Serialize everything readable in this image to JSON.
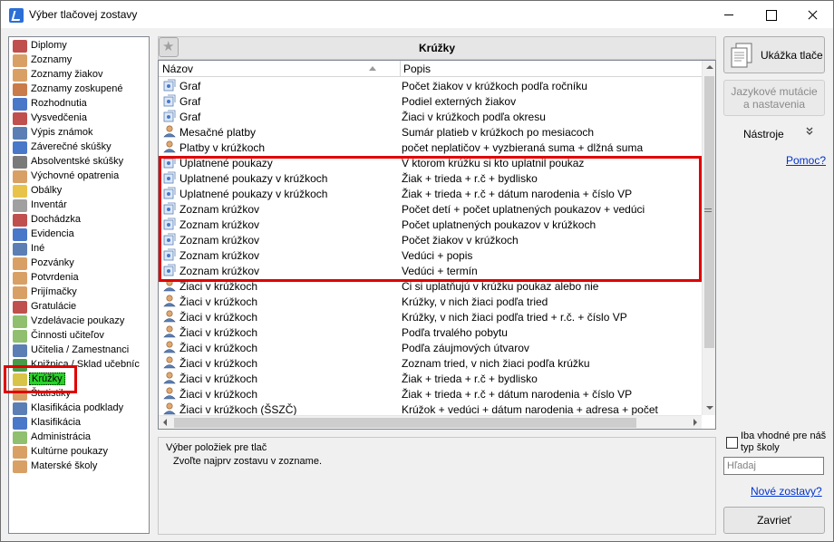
{
  "window": {
    "title": "Výber tlačovej zostavy"
  },
  "categories": [
    {
      "label": "Diplomy",
      "icon": "diploma-icon",
      "color": "#c0504d"
    },
    {
      "label": "Zoznamy",
      "icon": "person-icon",
      "color": "#d9a066"
    },
    {
      "label": "Zoznamy žiakov",
      "icon": "student-icon",
      "color": "#d9a066"
    },
    {
      "label": "Zoznamy zoskupené",
      "icon": "group-icon",
      "color": "#c97b4a"
    },
    {
      "label": "Rozhodnutia",
      "icon": "document-icon",
      "color": "#4a78c9"
    },
    {
      "label": "Vysvedčenia",
      "icon": "certificate-icon",
      "color": "#c0504d"
    },
    {
      "label": "Výpis známok",
      "icon": "grades-icon",
      "color": "#5b7fb5"
    },
    {
      "label": "Záverečné skúšky",
      "icon": "exam-icon",
      "color": "#4a78c9"
    },
    {
      "label": "Absolventské skúšky",
      "icon": "exam-icon",
      "color": "#7a7a7a"
    },
    {
      "label": "Výchovné opatrenia",
      "icon": "person-icon",
      "color": "#d9a066"
    },
    {
      "label": "Obálky",
      "icon": "envelope-icon",
      "color": "#e8c34a"
    },
    {
      "label": "Inventár",
      "icon": "inventory-icon",
      "color": "#a0a0a0"
    },
    {
      "label": "Dochádzka",
      "icon": "attendance-icon",
      "color": "#c0504d"
    },
    {
      "label": "Evidencia",
      "icon": "records-icon",
      "color": "#4a78c9"
    },
    {
      "label": "Iné",
      "icon": "person-icon",
      "color": "#5b7fb5"
    },
    {
      "label": "Pozvánky",
      "icon": "person-icon",
      "color": "#d9a066"
    },
    {
      "label": "Potvrdenia",
      "icon": "person-icon",
      "color": "#d9a066"
    },
    {
      "label": "Prijímačky",
      "icon": "person-icon",
      "color": "#d9a066"
    },
    {
      "label": "Gratulácie",
      "icon": "gift-icon",
      "color": "#c0504d"
    },
    {
      "label": "Vzdelávacie poukazy",
      "icon": "check-icon",
      "color": "#8fbf6f"
    },
    {
      "label": "Činnosti učiteľov",
      "icon": "check-icon",
      "color": "#8fbf6f"
    },
    {
      "label": "Učitelia / Zamestnanci",
      "icon": "teacher-icon",
      "color": "#5b7fb5"
    },
    {
      "label": "Knižnica / Sklad učebníc",
      "icon": "book-icon",
      "color": "#4a9a4a"
    },
    {
      "label": "Krúžky",
      "icon": "hobby-group-icon",
      "color": "#d9c44a",
      "selected": true
    },
    {
      "label": "Štatistiky",
      "icon": "statistics-icon",
      "color": "#d9a066"
    },
    {
      "label": "Klasifikácia podklady",
      "icon": "classification-icon",
      "color": "#5b7fb5"
    },
    {
      "label": "Klasifikácia",
      "icon": "grid-icon",
      "color": "#4a78c9"
    },
    {
      "label": "Administrácia",
      "icon": "admin-icon",
      "color": "#8fbf6f"
    },
    {
      "label": "Kultúrne poukazy",
      "icon": "culture-icon",
      "color": "#d9a066"
    },
    {
      "label": "Materské školy",
      "icon": "kindergarten-icon",
      "color": "#d9a066"
    }
  ],
  "main": {
    "title": "Krúžky",
    "columns": {
      "name": "Názov",
      "description": "Popis"
    },
    "rows": [
      {
        "name": "Graf",
        "description": "Počet žiakov v krúžkoch podľa ročníku",
        "icon": "report-icon"
      },
      {
        "name": "Graf",
        "description": "Podiel externých žiakov",
        "icon": "report-icon"
      },
      {
        "name": "Graf",
        "description": "Žiaci v krúžkoch podľa okresu",
        "icon": "report-icon"
      },
      {
        "name": "Mesačné platby",
        "description": "Sumár platieb v krúžkoch po mesiacoch",
        "icon": "person-report-icon"
      },
      {
        "name": "Platby v krúžkoch",
        "description": "počet neplatičov + vyzbieraná suma + dlžná suma",
        "icon": "person-report-icon"
      },
      {
        "name": "Uplatnené poukazy",
        "description": "V ktorom krúžku si kto uplatnil poukaz",
        "icon": "report-icon"
      },
      {
        "name": "Uplatnené poukazy v krúžkoch",
        "description": "Žiak + trieda + r.č + bydlisko",
        "icon": "report-icon"
      },
      {
        "name": "Uplatnené poukazy v krúžkoch",
        "description": "Žiak + trieda + r.č + dátum narodenia + číslo VP",
        "icon": "report-icon"
      },
      {
        "name": "Zoznam krúžkov",
        "description": "Počet detí + počet uplatnených poukazov + vedúci",
        "icon": "report-icon"
      },
      {
        "name": "Zoznam krúžkov",
        "description": "Počet uplatnených poukazov v krúžkoch",
        "icon": "report-icon"
      },
      {
        "name": "Zoznam krúžkov",
        "description": "Počet žiakov v krúžkoch",
        "icon": "report-icon"
      },
      {
        "name": "Zoznam krúžkov",
        "description": "Vedúci + popis",
        "icon": "report-icon"
      },
      {
        "name": "Zoznam krúžkov",
        "description": "Vedúci + termín",
        "icon": "report-icon"
      },
      {
        "name": "Žiaci v krúžkoch",
        "description": "Či si uplatňujú v krúžku poukaz alebo nie",
        "icon": "person-report-icon"
      },
      {
        "name": "Žiaci v krúžkoch",
        "description": "Krúžky, v nich žiaci podľa tried",
        "icon": "person-report-icon"
      },
      {
        "name": "Žiaci v krúžkoch",
        "description": "Krúžky, v nich žiaci podľa tried + r.č. + číslo VP",
        "icon": "person-report-icon"
      },
      {
        "name": "Žiaci v krúžkoch",
        "description": "Podľa trvalého pobytu",
        "icon": "person-report-icon"
      },
      {
        "name": "Žiaci v krúžkoch",
        "description": "Podľa záujmových útvarov",
        "icon": "person-report-icon"
      },
      {
        "name": "Žiaci v krúžkoch",
        "description": "Zoznam tried, v nich žiaci podľa krúžku",
        "icon": "person-report-icon"
      },
      {
        "name": "Žiaci v krúžkoch",
        "description": "Žiak + trieda + r.č + bydlisko",
        "icon": "person-report-icon"
      },
      {
        "name": "Žiaci v krúžkoch",
        "description": "Žiak + trieda + r.č + dátum narodenia + číslo VP",
        "icon": "person-report-icon"
      },
      {
        "name": "Žiaci v krúžkoch (ŠSZČ)",
        "description": "Krúžok + vedúci + dátum narodenia + adresa + počet",
        "icon": "person-report-icon"
      }
    ]
  },
  "selection_info": {
    "title": "Výber položiek pre tlač",
    "text": "Zvoľte najprv zostavu v zozname."
  },
  "right_panel": {
    "preview_label": "Ukážka tlače",
    "lang_label_line1": "Jazykové mutácie",
    "lang_label_line2": "a nastavenia",
    "tools_label": "Nástroje",
    "tools_chevron": "»",
    "help_link": "Pomoc?",
    "checkbox_label": "Iba vhodné pre náš typ školy",
    "checkbox_checked": false,
    "search_placeholder": "Hľadaj",
    "new_reports_link": "Nové zostavy?",
    "close_label": "Zavrieť"
  },
  "colors": {
    "highlight_red": "#e00000",
    "selected_green": "#29d129",
    "link_blue": "#0033cc"
  }
}
